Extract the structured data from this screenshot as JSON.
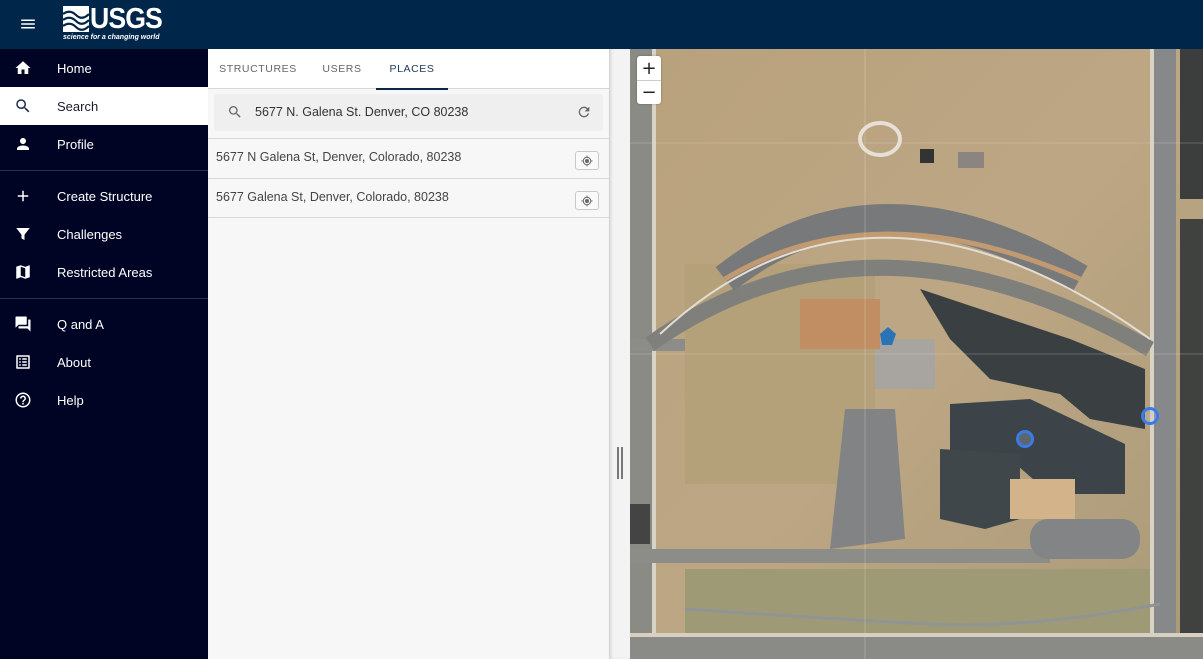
{
  "header": {
    "logo_text": "USGS",
    "logo_tagline": "science for a changing world",
    "menu_icon": "hamburger-menu-icon",
    "bar_color": "#002649"
  },
  "sidebar": {
    "background": "#000424",
    "groups": [
      [
        {
          "label": "Home",
          "icon": "home-icon",
          "active": false
        },
        {
          "label": "Search",
          "icon": "search-icon",
          "active": true
        },
        {
          "label": "Profile",
          "icon": "person-icon",
          "active": false
        }
      ],
      [
        {
          "label": "Create Structure",
          "icon": "plus-icon",
          "active": false
        },
        {
          "label": "Challenges",
          "icon": "filter-icon",
          "active": false
        },
        {
          "label": "Restricted Areas",
          "icon": "map-icon",
          "active": false
        }
      ],
      [
        {
          "label": "Q and A",
          "icon": "forum-icon",
          "active": false
        },
        {
          "label": "About",
          "icon": "list-alt-icon",
          "active": false
        },
        {
          "label": "Help",
          "icon": "help-circle-icon",
          "active": false
        }
      ]
    ]
  },
  "panel": {
    "tabs": [
      {
        "label": "STRUCTURES",
        "active": false
      },
      {
        "label": "USERS",
        "active": false
      },
      {
        "label": "PLACES",
        "active": true
      }
    ],
    "search": {
      "value": "5677 N. Galena St. Denver, CO 80238",
      "search_icon": "search-icon",
      "refresh_icon": "refresh-icon"
    },
    "results": [
      {
        "text": "5677 N Galena St, Denver, Colorado, 80238",
        "action_icon": "locate-target-icon"
      },
      {
        "text": "5677 Galena St, Denver, Colorado, 80238",
        "action_icon": "locate-target-icon"
      }
    ]
  },
  "map": {
    "zoom_in": "+",
    "zoom_out": "−",
    "marker_color": "#3a7be8",
    "markers": [
      {
        "label": "structure-marker-1"
      },
      {
        "label": "structure-marker-2"
      }
    ]
  }
}
